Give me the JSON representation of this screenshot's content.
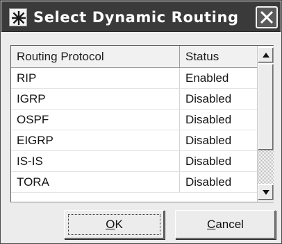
{
  "window": {
    "title": "Select Dynamic Routing ...",
    "icon": "window-app-icon",
    "close_icon": "close-icon"
  },
  "table": {
    "columns": [
      "Routing Protocol",
      "Status"
    ],
    "rows": [
      {
        "protocol": "RIP",
        "status": "Enabled"
      },
      {
        "protocol": "IGRP",
        "status": "Disabled"
      },
      {
        "protocol": "OSPF",
        "status": "Disabled"
      },
      {
        "protocol": "EIGRP",
        "status": "Disabled"
      },
      {
        "protocol": "IS-IS",
        "status": "Disabled"
      },
      {
        "protocol": "TORA",
        "status": "Disabled"
      }
    ]
  },
  "scrollbar": {
    "up_icon": "arrow-up-icon",
    "down_icon": "arrow-down-icon",
    "thumb_position_fraction": 0,
    "thumb_size_fraction": 0.72
  },
  "buttons": {
    "ok": {
      "mnemonic": "O",
      "rest": "K",
      "focused": true
    },
    "cancel": {
      "mnemonic": "C",
      "rest": "ancel"
    }
  },
  "colors": {
    "titlebar": "#3a3a3a",
    "title_text": "#ffffff",
    "dialog_bg": "#ececec",
    "list_bg": "#ffffff"
  }
}
